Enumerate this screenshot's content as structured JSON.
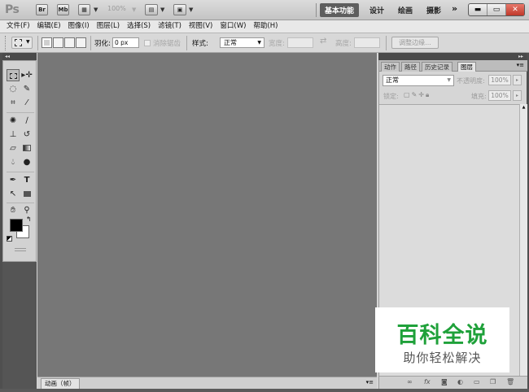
{
  "app": {
    "logo": "Ps",
    "buttons": {
      "bridge": "Br",
      "minibridge": "Mb"
    },
    "zoom": "100%"
  },
  "workspaces": {
    "items": [
      "基本功能",
      "设计",
      "绘画",
      "摄影"
    ],
    "active": "基本功能",
    "more": "»"
  },
  "window_controls": {
    "minimize": "▬",
    "restore": "▭",
    "close": "✕"
  },
  "menu": {
    "items": [
      "文件(F)",
      "编辑(E)",
      "图像(I)",
      "图层(L)",
      "选择(S)",
      "滤镜(T)",
      "视图(V)",
      "窗口(W)",
      "帮助(H)"
    ]
  },
  "options": {
    "feather_label": "羽化:",
    "feather_value": "0 px",
    "antialias_label": "消除锯齿",
    "style_label": "样式:",
    "style_value": "正常",
    "width_label": "宽度:",
    "height_label": "高度:",
    "refine_edge": "调整边缘..."
  },
  "toolbox": {
    "collapse": "◂◂"
  },
  "canvas_panel": {
    "animation_tab": "动画（帧）"
  },
  "dock": {
    "collapse": "▸▸"
  },
  "layers_panel": {
    "tabs": [
      "动作",
      "路径",
      "历史记录",
      "图层"
    ],
    "active_tab": "图层",
    "blend_mode": "正常",
    "opacity_label": "不透明度:",
    "opacity_value": "100%",
    "lock_label": "锁定:",
    "fill_label": "填充:",
    "fill_value": "100%"
  },
  "watermark": {
    "title": "百科全说",
    "subtitle": "助你轻松解决"
  },
  "colors": {
    "canvas_bg": "#777777",
    "watermark_green": "#1fa13a",
    "close_red": "#c0392b"
  }
}
